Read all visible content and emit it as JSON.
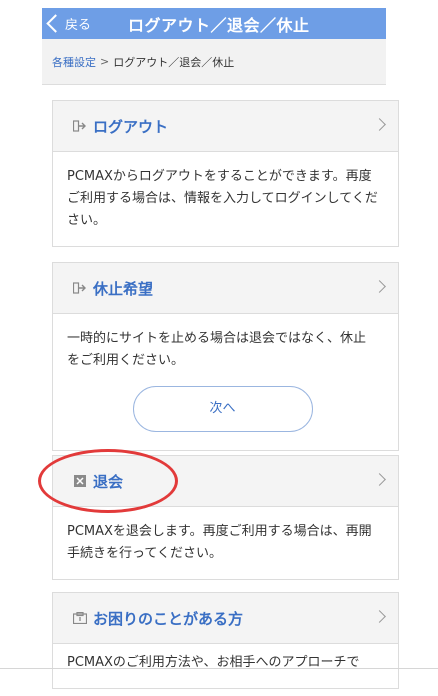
{
  "header": {
    "back_label": "戻る",
    "title": "ログアウト／退会／休止",
    "bg_color": "#6e9ee6"
  },
  "breadcrumb": {
    "parent": "各種設定",
    "separator": ">",
    "current": "ログアウト／退会／休止"
  },
  "sections": [
    {
      "id": "logout",
      "title": "ログアウト",
      "icon": "logout-arrow-icon",
      "body": "PCMAXからログアウトをすることができます。再度ご利用する場合は、情報を入力してログインしてください。"
    },
    {
      "id": "pause",
      "title": "休止希望",
      "icon": "pause-arrow-icon",
      "body": "一時的にサイトを止める場合は退会ではなく、休止をご利用ください。",
      "button": "次へ"
    },
    {
      "id": "withdraw",
      "title": "退会",
      "icon": "close-box-icon",
      "body": "PCMAXを退会します。再度ご利用する場合は、再開手続きを行ってください。"
    },
    {
      "id": "help",
      "title": "お困りのことがある方",
      "icon": "help-box-icon",
      "body_partial": "PCMAXのご利用方法や、お相手へのアプローチで"
    }
  ],
  "annotation": {
    "ring_color": "#e23a3a"
  }
}
